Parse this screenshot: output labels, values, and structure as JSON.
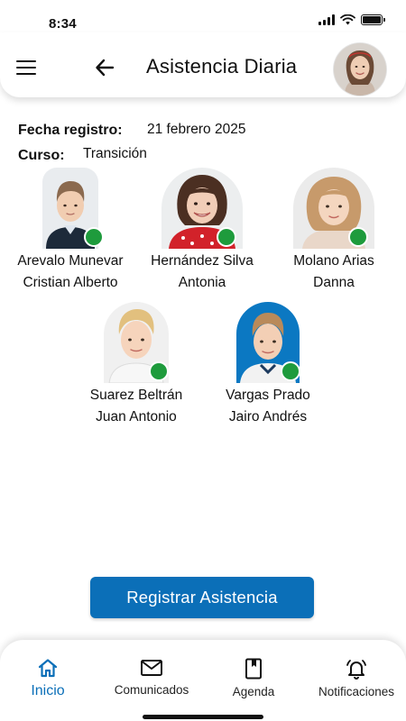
{
  "status_bar": {
    "time": "8:34"
  },
  "header": {
    "title": "Asistencia Diaria"
  },
  "info": {
    "date_label": "Fecha registro:",
    "date_value": "21 febrero 2025",
    "course_label": "Curso:",
    "course_value": "Transición"
  },
  "students": [
    {
      "line1": "Arevalo Munevar",
      "line2": "Cristian Alberto",
      "present": true
    },
    {
      "line1": "Hernández Silva",
      "line2": "Antonia",
      "present": true
    },
    {
      "line1": "Molano Arias",
      "line2": "Danna",
      "present": true
    },
    {
      "line1": "Suarez Beltrán",
      "line2": "Juan Antonio",
      "present": true
    },
    {
      "line1": "Vargas Prado",
      "line2": "Jairo Andrés",
      "present": true
    }
  ],
  "register_button": "Registrar Asistencia",
  "nav": {
    "items": [
      {
        "label": "Inicio",
        "icon": "home-icon",
        "active": true
      },
      {
        "label": "Comunicados",
        "icon": "mail-icon",
        "active": false
      },
      {
        "label": "Agenda",
        "icon": "agenda-book-icon",
        "active": false
      },
      {
        "label": "Notificaciones",
        "icon": "bell-icon",
        "active": false
      }
    ]
  },
  "colors": {
    "accent": "#0b6fb8",
    "present": "#1e9b3c"
  }
}
